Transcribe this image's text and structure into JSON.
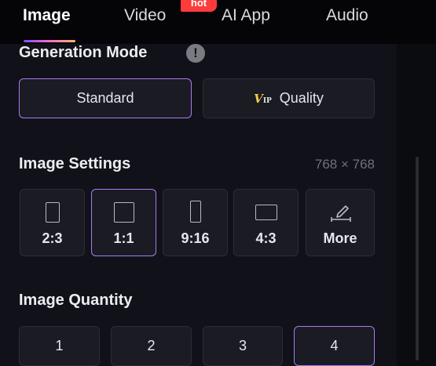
{
  "tabs": [
    {
      "label": "Image",
      "active": true
    },
    {
      "label": "Video",
      "active": false
    },
    {
      "label": "AI App",
      "active": false
    },
    {
      "label": "Audio",
      "active": false
    }
  ],
  "hot_badge": "hot",
  "generation_mode": {
    "title": "Generation Mode",
    "options": [
      {
        "label": "Standard",
        "selected": true
      },
      {
        "label": "Quality",
        "selected": false,
        "badge": "V",
        "badge_sub": "IP"
      }
    ]
  },
  "image_settings": {
    "title": "Image Settings",
    "dimensions": "768 × 768",
    "ratios": [
      {
        "label": "2:3",
        "selected": false
      },
      {
        "label": "1:1",
        "selected": true
      },
      {
        "label": "9:16",
        "selected": false
      },
      {
        "label": "4:3",
        "selected": false
      },
      {
        "label": "More",
        "selected": false
      }
    ]
  },
  "image_quantity": {
    "title": "Image Quantity",
    "options": [
      {
        "label": "1",
        "selected": false
      },
      {
        "label": "2",
        "selected": false
      },
      {
        "label": "3",
        "selected": false
      },
      {
        "label": "4",
        "selected": true
      }
    ]
  },
  "colors": {
    "accent": "#a77bf0",
    "vip": "#f2c94c",
    "hot": "#ff3b3b"
  }
}
